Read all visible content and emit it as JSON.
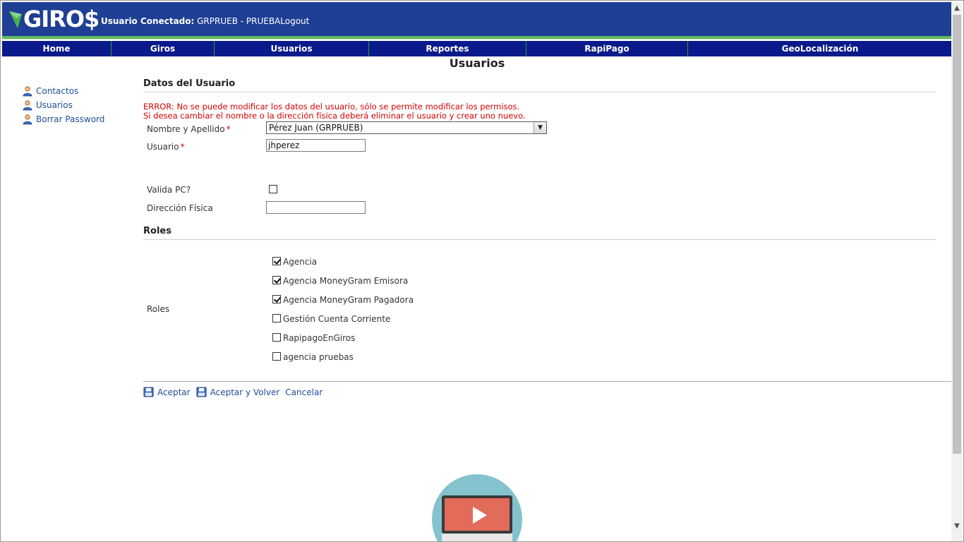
{
  "header": {
    "logo_text": "GIRO$",
    "user_label": "Usuario Conectado:",
    "user_value": " GRPRUEB - PRUEBA",
    "logout_label": "Logout",
    "bg_color": "#1f3f94"
  },
  "nav": {
    "items": [
      {
        "label": "Home"
      },
      {
        "label": "Giros"
      },
      {
        "label": "Usuarios"
      },
      {
        "label": "Reportes"
      },
      {
        "label": "RapiPago"
      },
      {
        "label": "GeoLocalización"
      }
    ]
  },
  "page_title": "Usuarios",
  "sidebar": {
    "items": [
      {
        "label": "Contactos",
        "icon": "user-icon"
      },
      {
        "label": "Usuarios",
        "icon": "user-icon"
      },
      {
        "label": "Borrar Password",
        "icon": "user-icon"
      }
    ]
  },
  "form": {
    "section_user": "Datos del Usuario",
    "error_line1": "ERROR: No se puede modificar los datos del usuario, sólo se permite modificar los permisos.",
    "error_line2": "Si desea cambiar el nombre o la dirección física deberá eliminar el usuario y crear uno nuevo.",
    "nombre_label": "Nombre y Apellido",
    "nombre_value": "Pérez Juan (GRPRUEB)",
    "usuario_label": "Usuario",
    "usuario_value": "jhperez",
    "required_mark": "*",
    "valida_pc_label": "Valida PC?",
    "valida_pc_checked": false,
    "direccion_label": "Dirección Física",
    "direccion_value": "",
    "section_roles": "Roles",
    "roles_label": "Roles",
    "roles": [
      {
        "label": "Agencia",
        "checked": true
      },
      {
        "label": "Agencia MoneyGram Emisora",
        "checked": true
      },
      {
        "label": "Agencia MoneyGram Pagadora",
        "checked": true
      },
      {
        "label": "Gestión Cuenta Corriente",
        "checked": false
      },
      {
        "label": "RapipagoEnGiros",
        "checked": false
      },
      {
        "label": "agencia pruebas",
        "checked": false
      }
    ]
  },
  "actions": {
    "accept": "Aceptar",
    "accept_back": "Aceptar y Volver",
    "cancel": "Cancelar"
  },
  "video_widget": {
    "icon": "play-icon"
  }
}
